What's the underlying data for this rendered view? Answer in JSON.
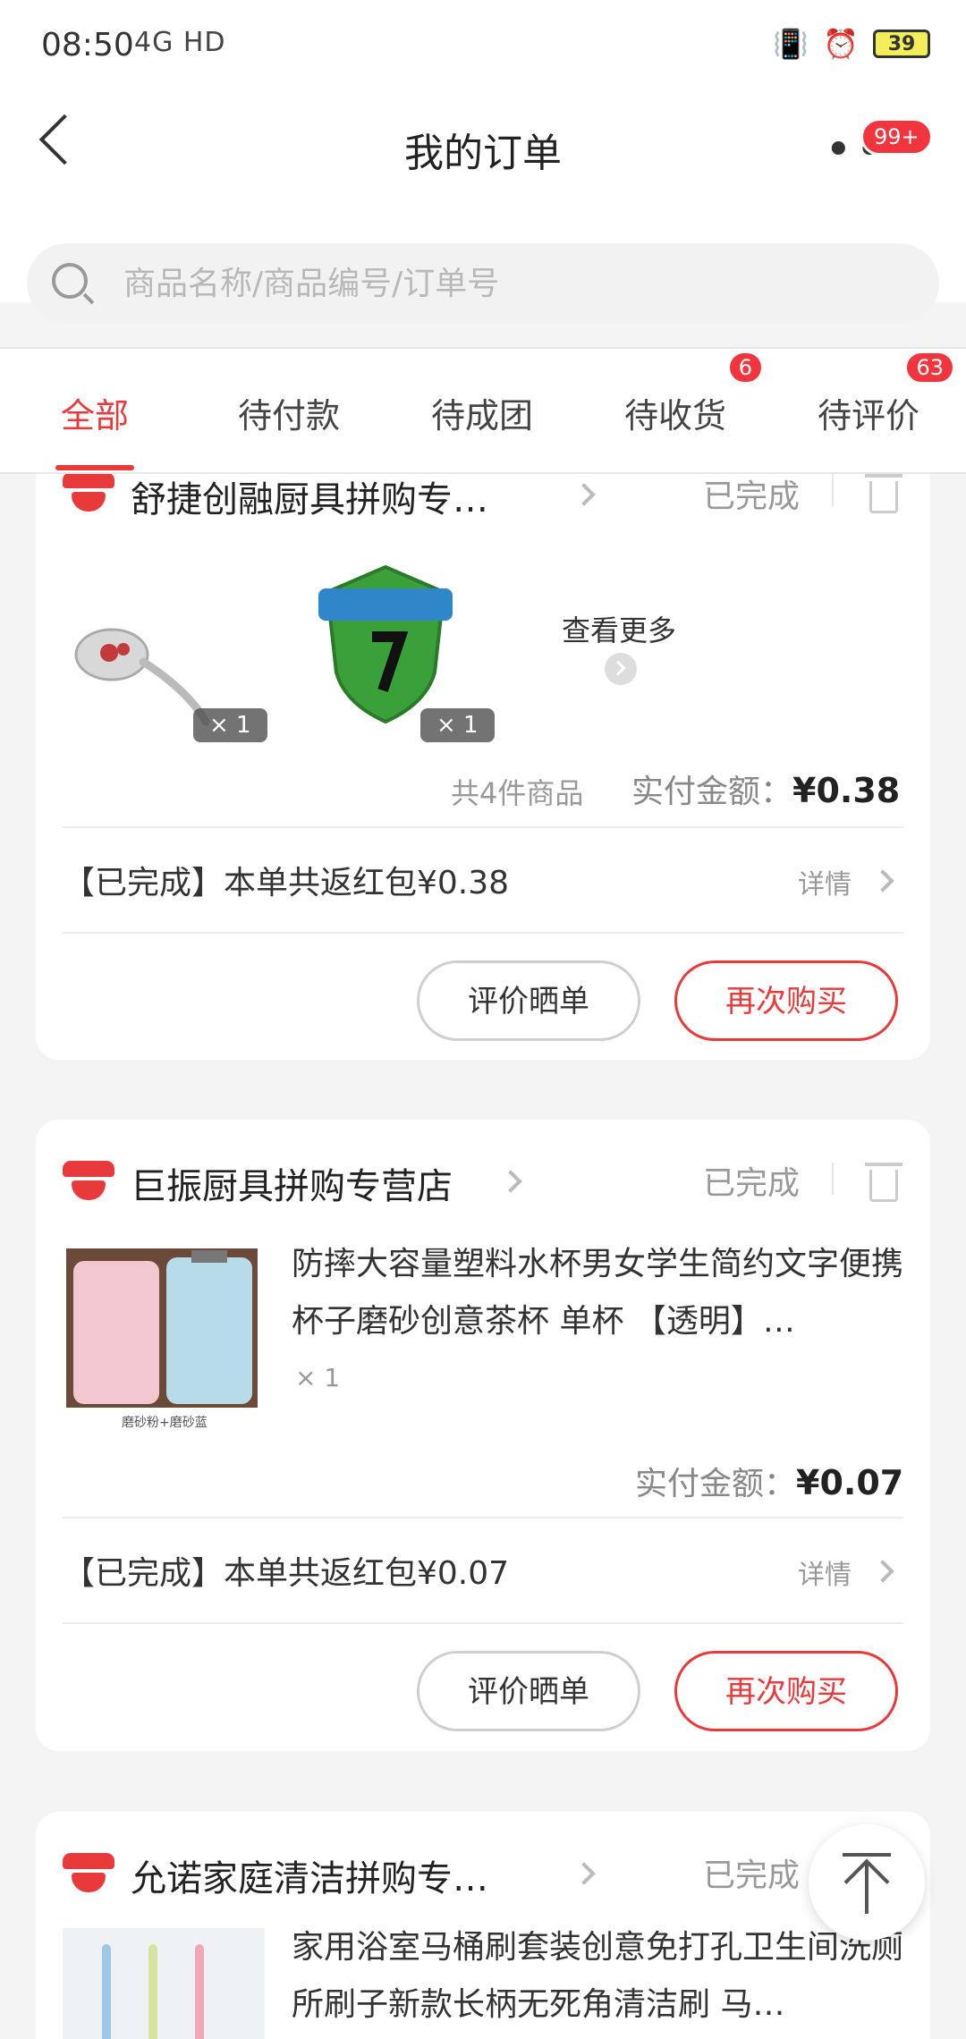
{
  "status_bar": {
    "time": "08:50",
    "network": "4G  HD",
    "battery": "39"
  },
  "header": {
    "title": "我的订单",
    "more_badge": "99+"
  },
  "search": {
    "placeholder": "商品名称/商品编号/订单号"
  },
  "tabs": [
    {
      "label": "全部",
      "active": true
    },
    {
      "label": "待付款"
    },
    {
      "label": "待成团"
    },
    {
      "label": "待收货",
      "badge": "6"
    },
    {
      "label": "待评价",
      "badge": "63"
    }
  ],
  "orders": [
    {
      "shop": "舒捷创融厨具拼购专…",
      "status": "已完成",
      "items": [
        {
          "qty": "× 1"
        },
        {
          "qty": "× 1"
        }
      ],
      "see_more": "查看更多",
      "count_text": "共4件商品",
      "pay_label": "实付金额：",
      "pay_amount": "¥0.38",
      "refund_text": "【已完成】本单共返红包¥0.38",
      "detail": "详情",
      "btn_review": "评价晒单",
      "btn_rebuy": "再次购买"
    },
    {
      "shop": "巨振厨具拼购专营店",
      "status": "已完成",
      "product_title": "防摔大容量塑料水杯男女学生简约文字便携杯子磨砂创意茶杯 单杯 【透明】…",
      "qty": "× 1",
      "thumb_caption": "磨砂粉+磨砂蓝",
      "pay_label": "实付金额：",
      "pay_amount": "¥0.07",
      "refund_text": "【已完成】本单共返红包¥0.07",
      "detail": "详情",
      "btn_review": "评价晒单",
      "btn_rebuy": "再次购买"
    },
    {
      "shop": "允诺家庭清洁拼购专…",
      "status": "已完成",
      "product_title": "家用浴室马桶刷套装创意免打孔卫生间洗厕所刷子新款长柄无死角清洁刷 马…"
    }
  ],
  "colors": {
    "accent": "#e8393b",
    "badge": "#f0353f"
  }
}
